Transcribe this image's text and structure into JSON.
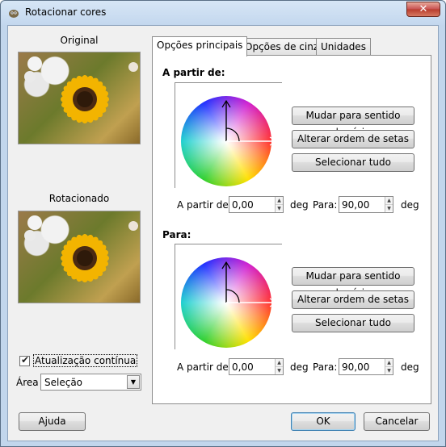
{
  "window": {
    "title": "Rotacionar cores",
    "close_label": "✕"
  },
  "left": {
    "original_label": "Original",
    "rotated_label": "Rotacionado",
    "continuous_update_label": "Atualização contínua",
    "continuous_update_checked": true,
    "area_label": "Área",
    "area_value": "Seleção"
  },
  "tabs": [
    {
      "label": "Opções principais",
      "active": true
    },
    {
      "label": "Opções de cinza",
      "active": false
    },
    {
      "label": "Unidades",
      "active": false
    }
  ],
  "from_section": {
    "title": "A partir de:",
    "clockwise_label": "Mudar para sentido horário",
    "swap_label": "Alterar ordem de setas",
    "select_all_label": "Selecionar tudo",
    "from_label": "A partir de:",
    "from_value": "0,00",
    "from_unit": "deg",
    "to_label": "Para:",
    "to_value": "90,00",
    "to_unit": "deg"
  },
  "to_section": {
    "title": "Para:",
    "clockwise_label": "Mudar para sentido horário",
    "swap_label": "Alterar ordem de setas",
    "select_all_label": "Selecionar tudo",
    "from_label": "A partir de:",
    "from_value": "0,00",
    "from_unit": "deg",
    "to_label": "Para:",
    "to_value": "90,00",
    "to_unit": "deg"
  },
  "footer": {
    "help_label": "Ajuda",
    "ok_label": "OK",
    "cancel_label": "Cancelar"
  },
  "icons": {
    "app": "gimp-icon",
    "close": "close-icon",
    "checkbox": "check-icon",
    "dropdown": "chevron-down-icon",
    "spin_up": "spin-up-icon",
    "spin_down": "spin-down-icon"
  }
}
